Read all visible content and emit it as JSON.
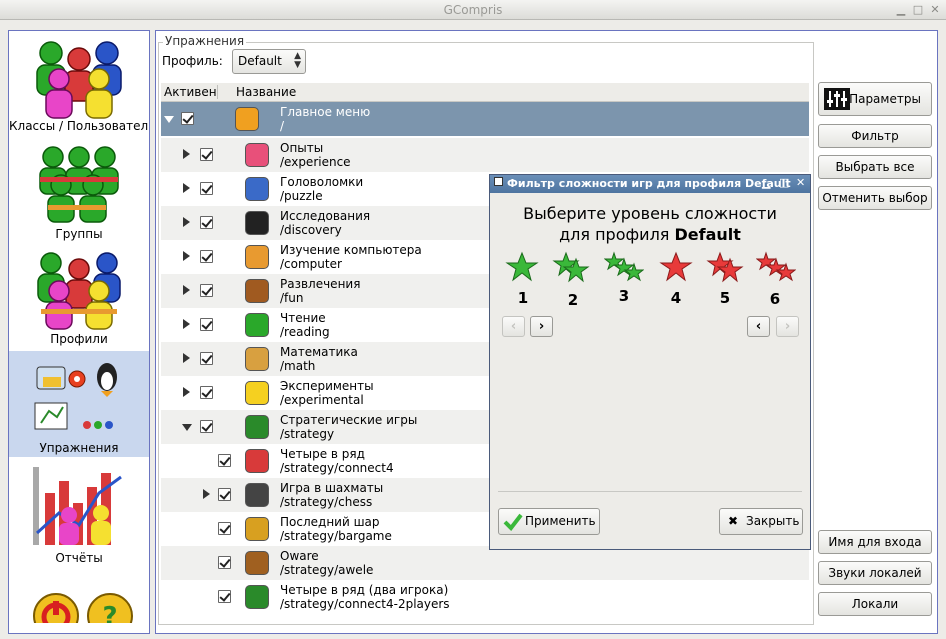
{
  "window": {
    "title": "GCompris"
  },
  "sidebar": {
    "items": [
      {
        "label": "Классы / Пользователи",
        "icon": "users-group-icon"
      },
      {
        "label": "Группы",
        "icon": "groups-icon"
      },
      {
        "label": "Профили",
        "icon": "profiles-icon"
      },
      {
        "label": "Упражнения",
        "icon": "activities-icon"
      },
      {
        "label": "Отчёты",
        "icon": "reports-icon"
      }
    ]
  },
  "activities": {
    "frame_label": "Упражнения",
    "profile_label": "Профиль:",
    "profile_value": "Default",
    "col_active": "Активен",
    "col_name": "Название",
    "rows": [
      {
        "name": "Главное меню",
        "path": "/",
        "icon": "plane-icon",
        "expand": "down"
      },
      {
        "name": "Опыты",
        "path": "/experience",
        "icon": "pig-icon",
        "expand": "right"
      },
      {
        "name": "Головоломки",
        "path": "/puzzle",
        "icon": "puzzle-icon",
        "expand": "right"
      },
      {
        "name": "Исследования",
        "path": "/discovery",
        "icon": "tux-icon",
        "expand": "right"
      },
      {
        "name": "Изучение компьютера",
        "path": "/computer",
        "icon": "computer-icon",
        "expand": "right"
      },
      {
        "name": "Развлечения",
        "path": "/fun",
        "icon": "bear-icon",
        "expand": "right"
      },
      {
        "name": "Чтение",
        "path": "/reading",
        "icon": "reading-icon",
        "expand": "right"
      },
      {
        "name": "Математика",
        "path": "/math",
        "icon": "math-icon",
        "expand": "right"
      },
      {
        "name": "Эксперименты",
        "path": "/experimental",
        "icon": "warning-icon",
        "expand": "right"
      },
      {
        "name": "Стратегические игры",
        "path": "/strategy",
        "icon": "strategy-icon",
        "expand": "down"
      },
      {
        "name": "Четыре в ряд",
        "path": "/strategy/connect4",
        "icon": "connect4-icon",
        "expand": "none"
      },
      {
        "name": "Игра в шахматы",
        "path": "/strategy/chess",
        "icon": "chess-icon",
        "expand": "right"
      },
      {
        "name": "Последний шар",
        "path": "/strategy/bargame",
        "icon": "bargame-icon",
        "expand": "none"
      },
      {
        "name": "Oware",
        "path": "/strategy/awele",
        "icon": "awele-icon",
        "expand": "none"
      },
      {
        "name": "Четыре в ряд (два игрока)",
        "path": "/strategy/connect4-2players",
        "icon": "connect4-2p-icon",
        "expand": "none"
      }
    ]
  },
  "right_buttons": {
    "params": "Параметры",
    "filter": "Фильтр",
    "select_all": "Выбрать все",
    "deselect": "Отменить выбор",
    "login_name": "Имя для входа",
    "locale_sounds": "Звуки локалей",
    "locale": "Локали"
  },
  "dialog": {
    "title": "Фильтр сложности игр для профиля Default",
    "heading_line1": "Выберите уровень сложности",
    "heading_line2_prefix": "для профиля ",
    "heading_line2_bold": "Default",
    "levels": [
      "1",
      "2",
      "3",
      "4",
      "5",
      "6"
    ],
    "apply": "Применить",
    "close": "Закрыть"
  },
  "colors": {
    "selected_row": "#7c95ad",
    "dialog_title": "#4e74a0",
    "sidebar_active": "#c9d7ee"
  }
}
